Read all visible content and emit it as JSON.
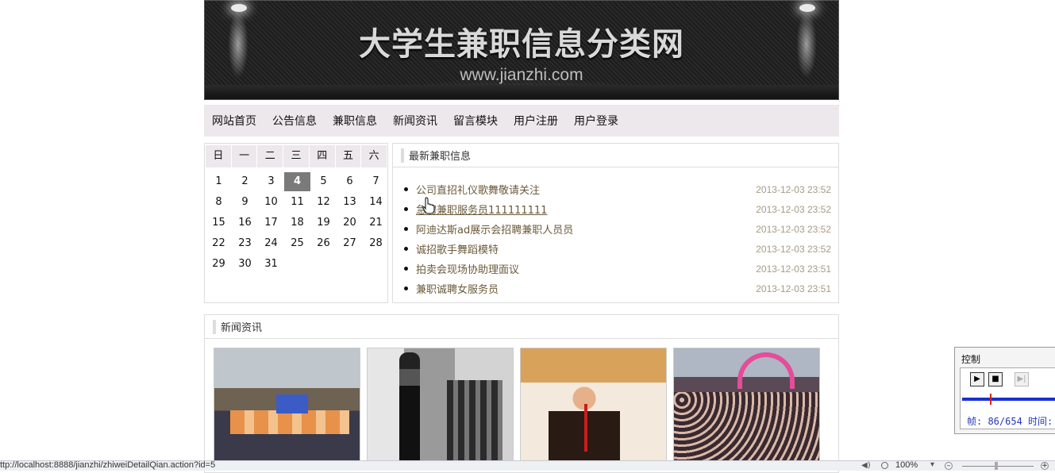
{
  "banner": {
    "title": "大学生兼职信息分类网",
    "url": "www.jianzhi.com"
  },
  "nav": {
    "items": [
      "网站首页",
      "公告信息",
      "兼职信息",
      "新闻资讯",
      "留言模块",
      "用户注册",
      "用户登录"
    ]
  },
  "calendar": {
    "weekdays": [
      "日",
      "一",
      "二",
      "三",
      "四",
      "五",
      "六"
    ],
    "weeks": [
      [
        "1",
        "2",
        "3",
        "4",
        "5",
        "6",
        "7"
      ],
      [
        "8",
        "9",
        "10",
        "11",
        "12",
        "13",
        "14"
      ],
      [
        "15",
        "16",
        "17",
        "18",
        "19",
        "20",
        "21"
      ],
      [
        "22",
        "23",
        "24",
        "25",
        "26",
        "27",
        "28"
      ],
      [
        "29",
        "30",
        "31",
        "",
        "",
        "",
        ""
      ]
    ],
    "today": "4"
  },
  "jobs": {
    "title": "最新兼职信息",
    "items": [
      {
        "name": "公司直招礼仪歌舞敬请关注",
        "time": "2013-12-03 23:52"
      },
      {
        "name": "急聘兼职服务员111111111",
        "time": "2013-12-03 23:52"
      },
      {
        "name": "阿迪达斯ad展示会招聘兼职人员员",
        "time": "2013-12-03 23:52"
      },
      {
        "name": "诚招歌手舞蹈模特",
        "time": "2013-12-03 23:52"
      },
      {
        "name": "拍卖会现场协助理面议",
        "time": "2013-12-03 23:51"
      },
      {
        "name": "兼职诚聘女服务员",
        "time": "2013-12-03 23:51"
      }
    ]
  },
  "news": {
    "title": "新闻资讯"
  },
  "control": {
    "title": "控制",
    "frame_text": "帧: 86/654 时间:"
  },
  "status": {
    "url": "ttp://localhost:8888/jianzhi/zhiweiDetailQian.action?id=5",
    "zoom": "100%"
  },
  "colors": {
    "nav_bg": "#ede8eb",
    "job_link": "#6b5a3a",
    "job_time": "#a89a86",
    "today_bg": "#7a7a7a"
  }
}
